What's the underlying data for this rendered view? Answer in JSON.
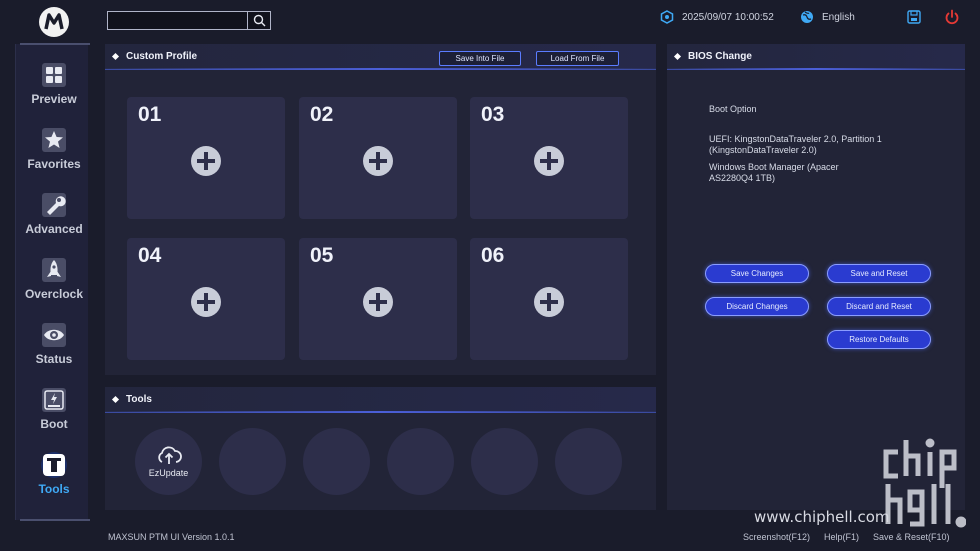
{
  "search": {
    "placeholder": ""
  },
  "header": {
    "datetime": "2025/09/07 10:00:52",
    "language": "English"
  },
  "sidebar": {
    "items": [
      {
        "label": "Preview",
        "icon": "grid-icon"
      },
      {
        "label": "Favorites",
        "icon": "star-icon"
      },
      {
        "label": "Advanced",
        "icon": "wrench-icon"
      },
      {
        "label": "Overclock",
        "icon": "rocket-icon"
      },
      {
        "label": "Status",
        "icon": "eye-icon"
      },
      {
        "label": "Boot",
        "icon": "ssd-icon"
      },
      {
        "label": "Tools",
        "icon": "tools-icon",
        "active": true
      }
    ]
  },
  "custom_profile": {
    "title": "Custom Profile",
    "save_label": "Save Into File",
    "load_label": "Load From File",
    "slots": [
      "01",
      "02",
      "03",
      "04",
      "05",
      "06"
    ]
  },
  "tools": {
    "title": "Tools",
    "items": [
      {
        "label": "EzUpdate",
        "icon": "cloud-upload-icon"
      },
      {
        "label": ""
      },
      {
        "label": ""
      },
      {
        "label": ""
      },
      {
        "label": ""
      },
      {
        "label": ""
      }
    ]
  },
  "bios_change": {
    "title": "BIOS Change",
    "boot_option_label": "Boot Option",
    "entries": [
      "UEFI: KingstonDataTraveler 2.0, Partition 1 (KingstonDataTraveler 2.0)",
      "Windows Boot Manager (Apacer AS2280Q4 1TB)"
    ],
    "buttons": {
      "save_changes": "Save Changes",
      "save_and_reset": "Save and Reset",
      "discard_changes": "Discard Changes",
      "discard_and_reset": "Discard and Reset",
      "restore_defaults": "Restore Defaults"
    }
  },
  "footer": {
    "version": "MAXSUN PTM UI Version 1.0.1",
    "screenshot": "Screenshot(F12)",
    "help": "Help(F1)",
    "save_reset": "Save & Reset(F10)"
  },
  "watermark": {
    "url": "www.chiphell.com",
    "logo_text": "chip hell"
  },
  "colors": {
    "accent": "#3fa9f5",
    "power": "#e53935",
    "button_blue": "#2a3bd0"
  }
}
